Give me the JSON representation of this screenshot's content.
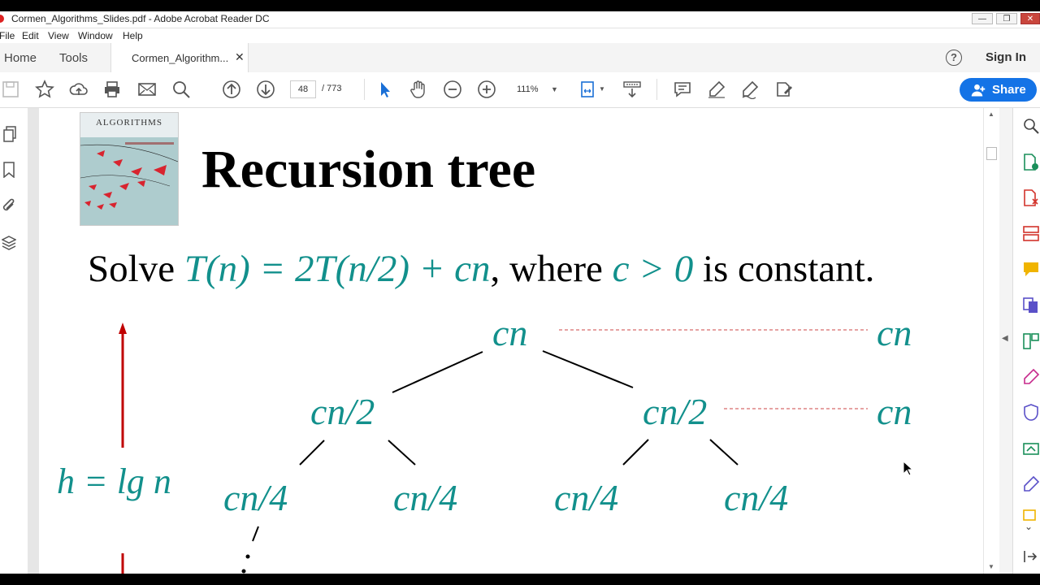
{
  "window": {
    "title": "Cormen_Algorithms_Slides.pdf - Adobe Acrobat Reader DC",
    "controls": [
      "—",
      "❐",
      "✕"
    ]
  },
  "menu": [
    "File",
    "Edit",
    "View",
    "Window",
    "Help"
  ],
  "tabs": {
    "home": "Home",
    "tools": "Tools",
    "document": "Cormen_Algorithm...",
    "close": "✕"
  },
  "header": {
    "help": "?",
    "signin": "Sign In"
  },
  "toolbar": {
    "page_current": "48",
    "page_total": "/ 773",
    "zoom": "111%",
    "share_label": "Share"
  },
  "slide": {
    "book_label": "ALGORITHMS",
    "title": "Recursion tree",
    "solve": {
      "prefix": "Solve ",
      "recurrence": "T(n) = 2T(n/2) + cn",
      "middle": ", where ",
      "condition": "c > 0",
      "suffix": " is constant."
    },
    "height_label": "h = lg n",
    "tree": {
      "root": "cn",
      "level1": [
        "cn/2",
        "cn/2"
      ],
      "level2": [
        "cn/4",
        "cn/4",
        "cn/4",
        "cn/4"
      ],
      "level_costs": [
        "cn",
        "cn"
      ]
    }
  },
  "colors": {
    "teal": "#12908c",
    "red": "#c00000",
    "accent": "#1473e6"
  }
}
